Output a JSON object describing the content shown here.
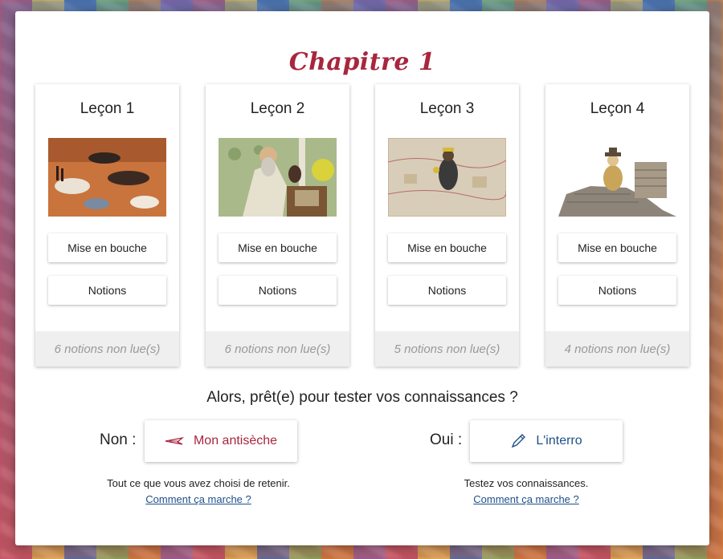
{
  "chapter": {
    "title": "Chapitre 1"
  },
  "lessons": [
    {
      "title": "Leçon 1",
      "image_icon": "cave-painting-image",
      "mise_label": "Mise en bouche",
      "notions_label": "Notions",
      "unread": "6 notions non lue(s)"
    },
    {
      "title": "Leçon 2",
      "image_icon": "scholar-illustration-image",
      "mise_label": "Mise en bouche",
      "notions_label": "Notions",
      "unread": "6 notions non lue(s)"
    },
    {
      "title": "Leçon 3",
      "image_icon": "medieval-map-image",
      "mise_label": "Mise en bouche",
      "notions_label": "Notions",
      "unread": "5 notions non lue(s)"
    },
    {
      "title": "Leçon 4",
      "image_icon": "explorer-ruins-image",
      "mise_label": "Mise en bouche",
      "notions_label": "Notions",
      "unread": "4 notions non lue(s)"
    }
  ],
  "quiz": {
    "question": "Alors, prêt(e) pour tester vos connaissances ?",
    "no": {
      "label": "Non :",
      "button": "Mon antisèche",
      "icon": "feather-pen-icon",
      "caption": "Tout ce que vous avez choisi de retenir.",
      "link": "Comment ça marche ?"
    },
    "yes": {
      "label": "Oui :",
      "button": "L'interro",
      "icon": "pencil-icon",
      "caption": "Testez vos connaissances.",
      "link": "Comment ça marche ?"
    }
  },
  "colors": {
    "accent": "#a8263e",
    "link": "#1f4f8a",
    "footer_bg": "#efefef"
  }
}
